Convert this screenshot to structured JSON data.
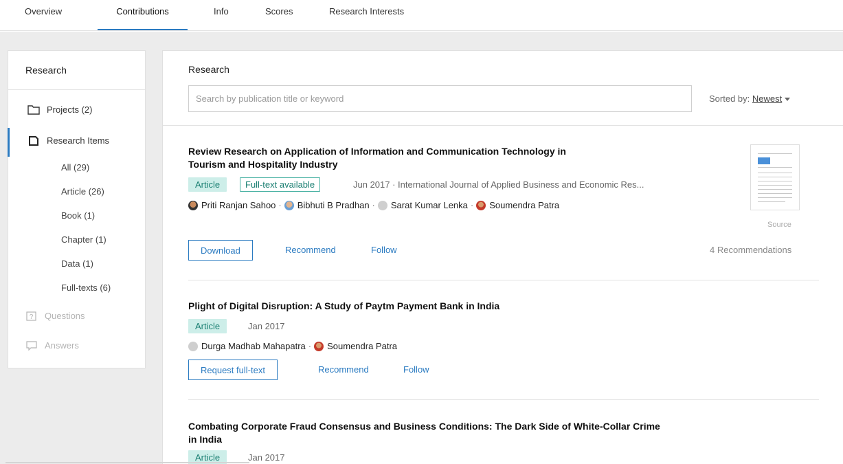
{
  "tabs": [
    "Overview",
    "Contributions",
    "Info",
    "Scores",
    "Research Interests"
  ],
  "active_tab": "Contributions",
  "sidebar": {
    "title": "Research",
    "projects": "Projects (2)",
    "research_items": "Research Items",
    "sub_items": [
      "All (29)",
      "Article (26)",
      "Book (1)",
      "Chapter (1)",
      "Data (1)",
      "Full-texts (6)"
    ],
    "questions": "Questions",
    "answers": "Answers"
  },
  "main": {
    "title": "Research",
    "search_placeholder": "Search by publication title or keyword",
    "sorted_label": "Sorted by:",
    "sorted_value": "Newest"
  },
  "publications": [
    {
      "title_line1": "Review Research on Application of Information and Communication Technology in",
      "title_line2": "Tourism and Hospitality Industry",
      "type": "Article",
      "fulltext": "Full-text available",
      "meta": "Jun 2017 · International Journal of Applied Business and Economic Res...",
      "authors": [
        "Priti Ranjan Sahoo",
        "Bibhuti B Pradhan",
        "Sarat Kumar Lenka",
        "Soumendra Patra"
      ],
      "primary_action": "Download",
      "recommend": "Recommend",
      "follow": "Follow",
      "recommendations": "4 Recommendations",
      "thumb_caption": "Source"
    },
    {
      "title_line1": "Plight of Digital Disruption: A Study of Paytm Payment Bank in India",
      "type": "Article",
      "meta": "Jan 2017",
      "authors": [
        "Durga Madhab Mahapatra",
        "Soumendra Patra"
      ],
      "primary_action": "Request full-text",
      "recommend": "Recommend",
      "follow": "Follow"
    },
    {
      "title_line1": "Combating Corporate Fraud Consensus and Business Conditions: The Dark Side of White-Collar Crime",
      "title_line2": "in India",
      "type": "Article",
      "meta": "Jan 2017"
    }
  ]
}
